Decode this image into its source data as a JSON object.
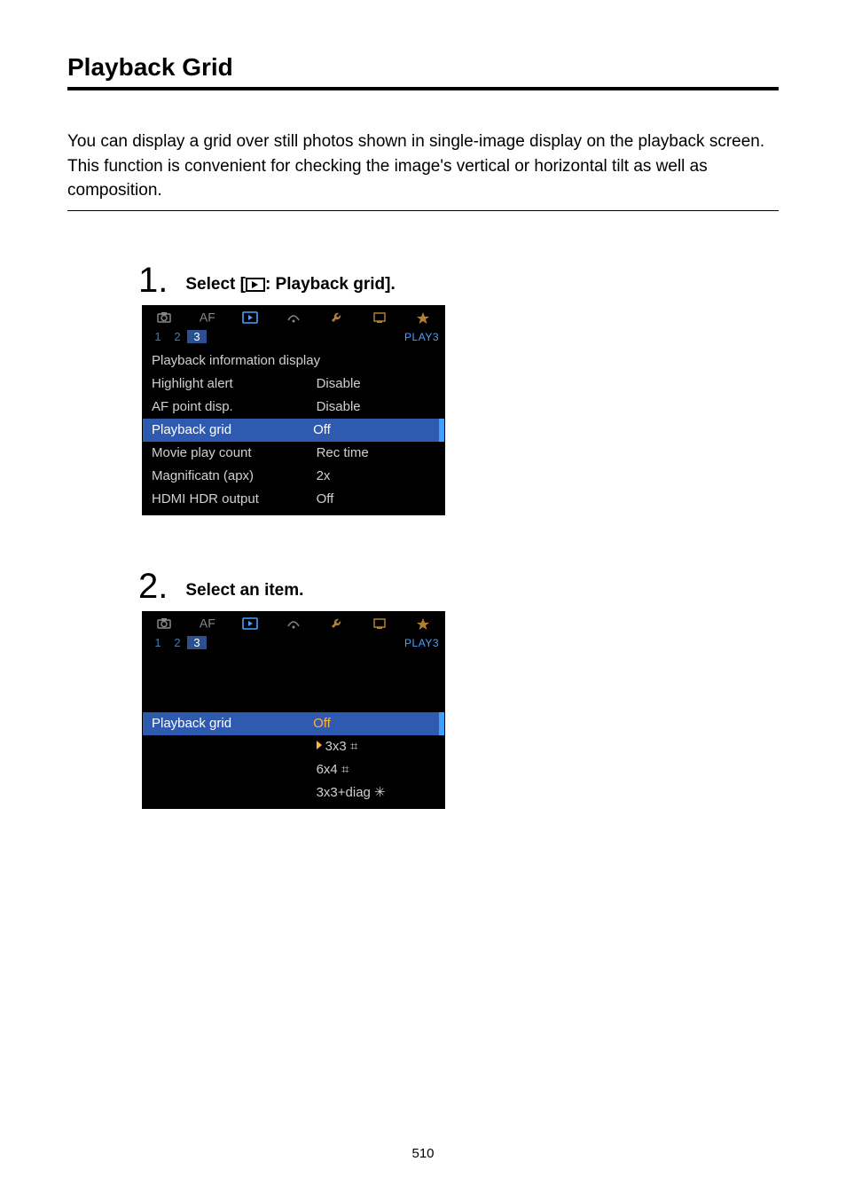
{
  "page_title": "Playback Grid",
  "intro": "You can display a grid over still photos shown in single-image display on the playback screen. This function is convenient for checking the image's vertical or horizontal tilt as well as composition.",
  "page_number": "510",
  "tab_icons": [
    "camera",
    "AF",
    "play",
    "wireless",
    "wrench",
    "custom",
    "star"
  ],
  "page_tag": "PLAY3",
  "page_numbers": [
    "1",
    "2",
    "3"
  ],
  "active_tab_index": 2,
  "active_page_index": 2,
  "steps": [
    {
      "num": "1.",
      "title_prefix": "Select [",
      "title_suffix": ": Playback grid].",
      "menu_rows": [
        {
          "label": "Playback information display",
          "value": "",
          "highlight": false,
          "title_only": true
        },
        {
          "label": "Highlight alert",
          "value": "Disable",
          "highlight": false
        },
        {
          "label": "AF point disp.",
          "value": "Disable",
          "highlight": false
        },
        {
          "label": "Playback grid",
          "value": "Off",
          "highlight": true
        },
        {
          "label": "Movie play count",
          "value": "Rec time",
          "highlight": false
        },
        {
          "label": "Magnificatn (apx)",
          "value": "2x",
          "highlight": false
        },
        {
          "label": "HDMI HDR output",
          "value": "Off",
          "highlight": false
        }
      ]
    },
    {
      "num": "2.",
      "title": "Select an item.",
      "menu_rows": [
        {
          "label": "Playback grid",
          "value": "Off",
          "highlight": true,
          "val_sel": true
        },
        {
          "label": "",
          "value": "3x3 ⌗",
          "highlight": false,
          "has_tri": true
        },
        {
          "label": "",
          "value": "6x4 ⌗",
          "highlight": false
        },
        {
          "label": "",
          "value": "3x3+diag ✳",
          "highlight": false
        }
      ]
    }
  ]
}
